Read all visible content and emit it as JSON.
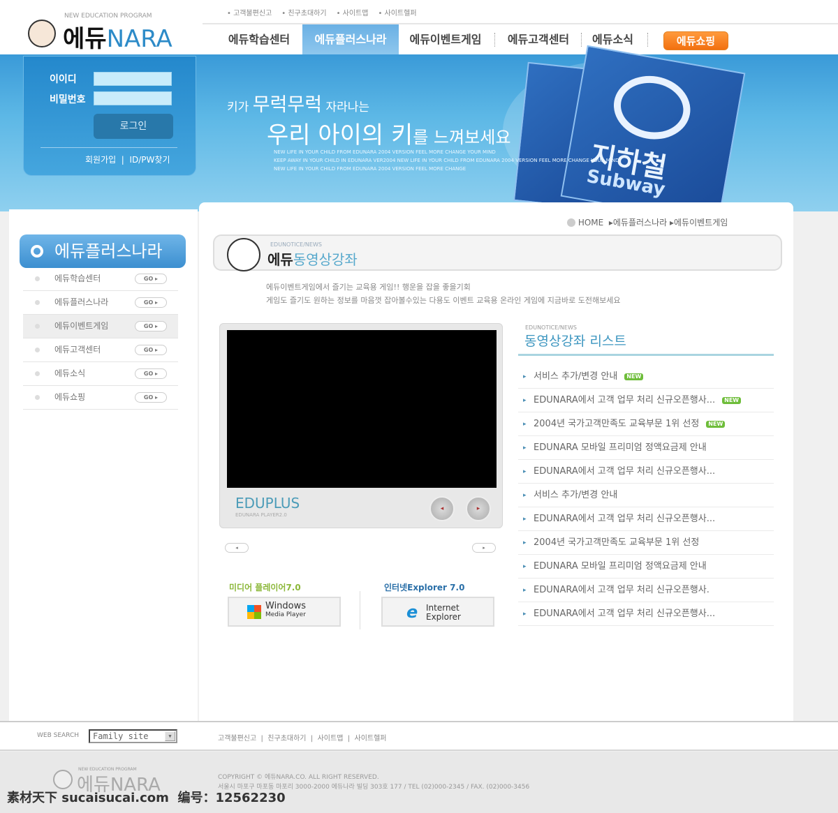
{
  "brand": {
    "tagline": "NEW EDUCATION PROGRAM",
    "name_ko": "에듀",
    "name_en": "NARA"
  },
  "top_links": [
    "고객불편신고",
    "친구초대하기",
    "사이트맵",
    "사이트헬퍼"
  ],
  "nav": {
    "tabs": [
      {
        "label": "에듀학습센터"
      },
      {
        "label": "에듀플러스나라",
        "active": true
      },
      {
        "label": "에듀이벤트게임"
      },
      {
        "label": "에듀고객센터"
      },
      {
        "label": "에듀소식"
      }
    ],
    "shop": "에듀쇼핑"
  },
  "login": {
    "id_label": "이이디",
    "pw_label": "비밀번호",
    "button": "로그인",
    "join": "회원가입",
    "find": "ID/PW찾기"
  },
  "banner": {
    "line1a": "키가",
    "line1b": "무럭무럭",
    "line1c": "자라나는",
    "line2a": "우리 아이의 키",
    "line2b": "를 느껴보세요",
    "english": [
      "NEW LIFE IN YOUR CHILD FROM EDUNARA 2004 VERSION FEEL MORE CHANGE YOUR MIND",
      "KEEP AWAY IN YOUR CHILD IN EDUNARA VER2004 NEW LIFE IN YOUR CHILD FROM EDUNARA 2004 VERSION FEEL MORE CHANGE YOUR MIND",
      "NEW LIFE IN YOUR CHILD FROM EDUNARA 2004 VERSION FEEL MORE CHANGE"
    ],
    "card_text": "지하철",
    "card_sub": "Subway"
  },
  "sidebar": {
    "title": "에듀플러스나라",
    "go": "GO ▸",
    "items": [
      {
        "label": "에듀학습센터"
      },
      {
        "label": "에듀플러스나라"
      },
      {
        "label": "에듀이벤트게임",
        "active": true
      },
      {
        "label": "에듀고객센터"
      },
      {
        "label": "에듀소식"
      },
      {
        "label": "에듀쇼핑"
      }
    ]
  },
  "breadcrumb": {
    "home": "HOME",
    "items": [
      "에듀플러스나라",
      "에듀이벤트게임"
    ]
  },
  "page": {
    "small": "EDUNOTICE/NEWS",
    "title_a": "에듀",
    "title_b": "동영상강좌",
    "desc": [
      "에듀이벤트게임에서 즐기는 교육용 게임!! 행운을 잡을 좋을기회",
      "게임도 즐기도 원하는 정보를 마음껏 잡아볼수있는 다용도 이벤트 교육용 온라인 게임에 지금바로 도전해보세요"
    ]
  },
  "player": {
    "name": "EDUPLUS",
    "version": "EDUNARA PLAYER2.0",
    "prev": "◂",
    "next": "▸"
  },
  "downloads": [
    {
      "label": "미디어 플레이어7.0",
      "box1": "Windows",
      "box2": "Media Player"
    },
    {
      "label": "인터넷Explorer 7.0",
      "box1": "Internet",
      "box2": "Explorer"
    }
  ],
  "list": {
    "small": "EDUNOTICE/NEWS",
    "title": "동영상강좌 리스트",
    "new_badge": "NEW",
    "items": [
      {
        "text": "서비스 추가/변경 안내",
        "new": true
      },
      {
        "text": "EDUNARA에서 고객 업무 처리 신규오픈행사...",
        "new": true
      },
      {
        "text": "2004년 국가고객만족도 교육부문 1위 선정",
        "new": true
      },
      {
        "text": "EDUNARA 모바일 프리미엄 정액요금제 안내"
      },
      {
        "text": "EDUNARA에서 고객 업무 처리 신규오픈행사..."
      },
      {
        "text": "서비스 추가/변경 안내"
      },
      {
        "text": "EDUNARA에서 고객 업무 처리 신규오픈행사..."
      },
      {
        "text": "2004년 국가고객만족도 교육부문 1위 선정"
      },
      {
        "text": "EDUNARA 모바일 프리미엄 정액요금제 안내"
      },
      {
        "text": "EDUNARA에서 고객 업무 처리 신규오픈행사."
      },
      {
        "text": "EDUNARA에서 고객 업무 처리 신규오픈행사..."
      }
    ]
  },
  "footer": {
    "web_search": "WEB SEARCH",
    "family_site": "Family site",
    "links": [
      "고객불편신고",
      "친구초대하기",
      "사이트맵",
      "사이트헬퍼"
    ],
    "copyright": "COPYRIGHT © 에듀NARA.CO. ALL RIGHT RESERVED.",
    "address": "서울시 마포구 마포동 마포리 3000-2000 에듀나라 빌딩 303호 177 / TEL (02)000-2345 / FAX. (02)000-3456",
    "watermark": "素材天下 sucaisucai.com  编号：12562230"
  },
  "colors": {
    "accent": "#3c8fd0",
    "shop": "#f27010",
    "new": "#6ebd3a"
  }
}
